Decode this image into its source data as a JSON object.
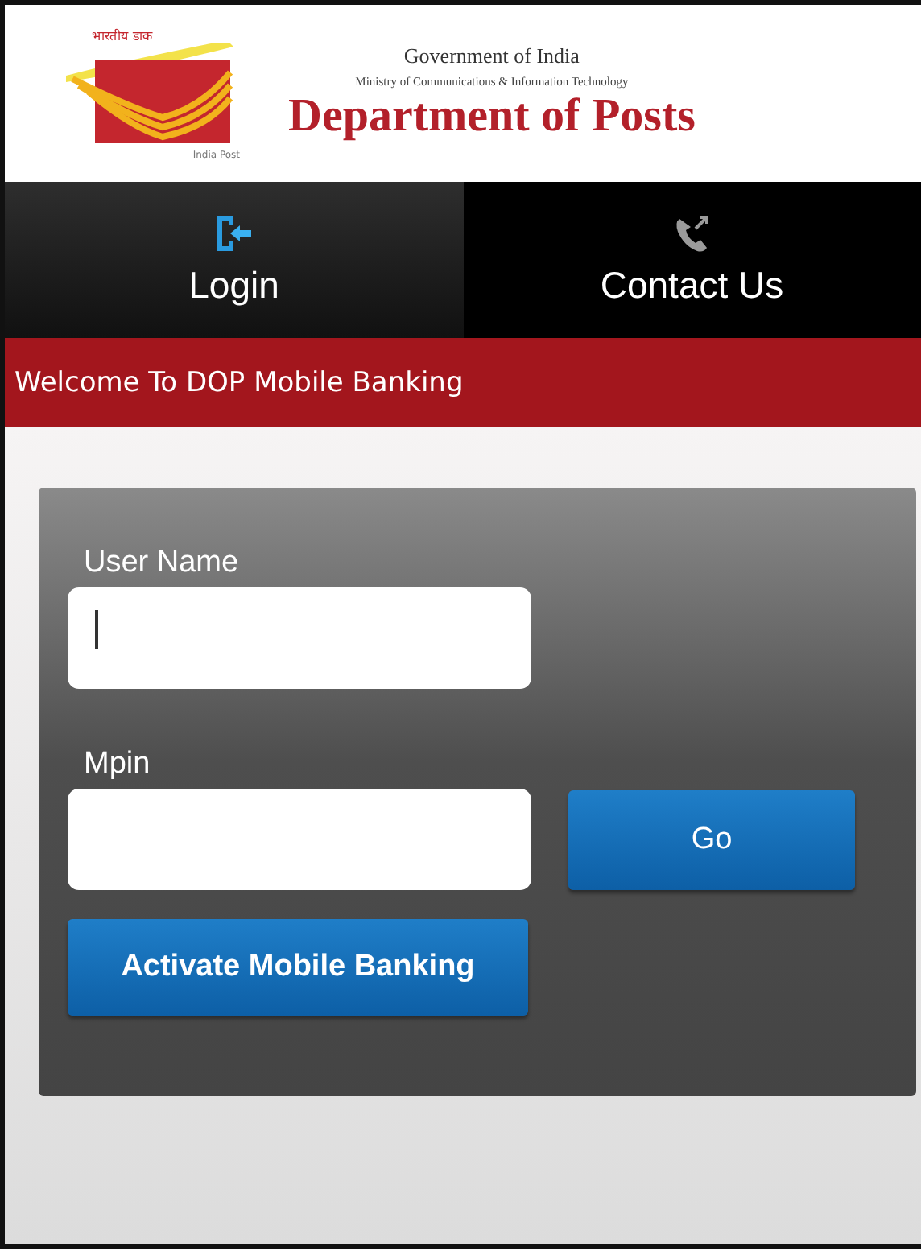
{
  "header": {
    "logo": {
      "top_text": "भारतीय डाक",
      "bottom_text": "India Post"
    },
    "line1": "Government of India",
    "line2": "Ministry of Communications & Information Technology",
    "title": "Department of Posts"
  },
  "tabs": [
    {
      "kind": "login",
      "label": "Login",
      "selected": true
    },
    {
      "kind": "contact",
      "label": "Contact Us",
      "selected": false
    }
  ],
  "banner": "Welcome To DOP Mobile Banking",
  "form": {
    "fields": [
      {
        "label": "User Name",
        "focused": true
      },
      {
        "label": "Mpin",
        "focused": false
      }
    ],
    "go_button": "Go",
    "activate_button": "Activate Mobile Banking"
  }
}
